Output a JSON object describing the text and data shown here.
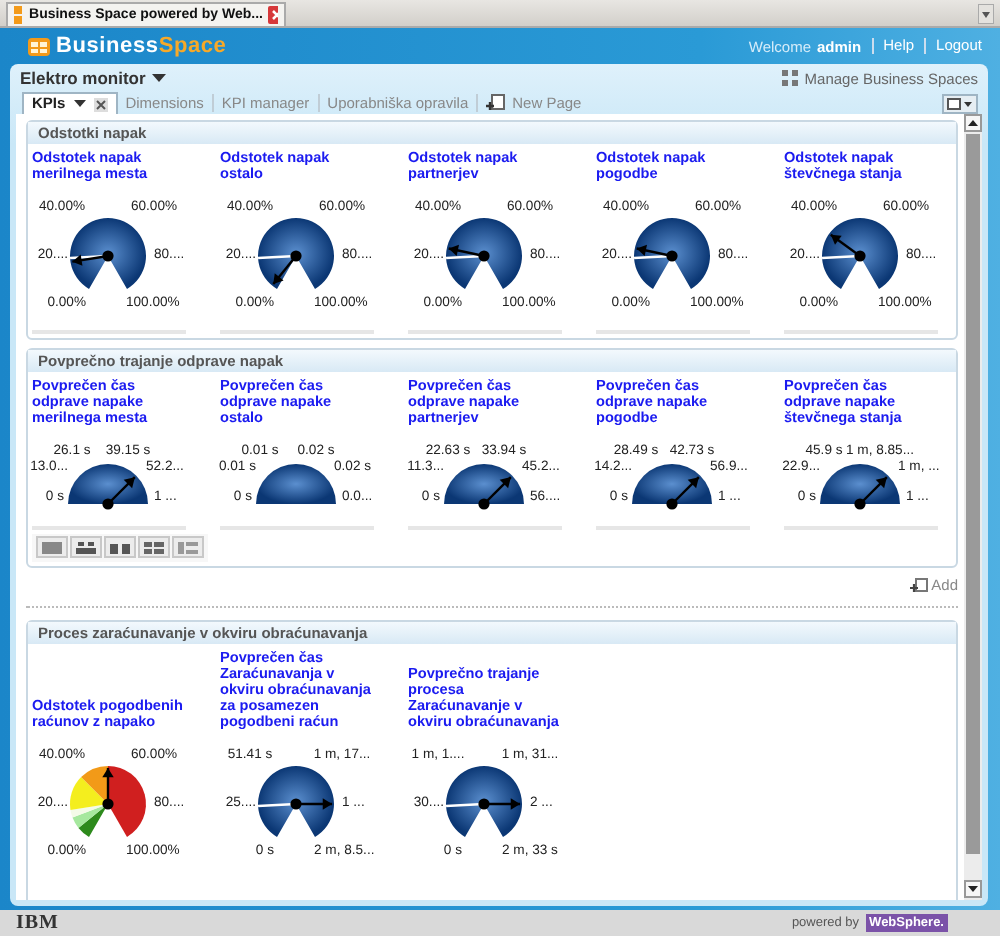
{
  "browser_tab": {
    "title": "Business Space powered by Web..."
  },
  "header": {
    "logo_business": "Business",
    "logo_space": "Space",
    "welcome": "Welcome",
    "user": "admin",
    "links": [
      "Help",
      "Logout"
    ]
  },
  "space": {
    "title": "Elektro monitor",
    "manage": "Manage Business Spaces"
  },
  "tabs": [
    {
      "label": "KPIs",
      "selected": true
    },
    {
      "label": "Dimensions",
      "selected": false
    },
    {
      "label": "KPI manager",
      "selected": false
    },
    {
      "label": "Uporabniška opravila",
      "selected": false
    }
  ],
  "new_page": "New Page",
  "sections": [
    {
      "title": "Odstotki napak",
      "gauges": [
        {
          "title": "Odstotek napak merilnega mesta",
          "kind": "pie",
          "labels": [
            "40.00%",
            "60.00%",
            "20....",
            "80....",
            "0.00%",
            "100.00%"
          ]
        },
        {
          "title": "Odstotek napak ostalo",
          "kind": "pie",
          "labels": [
            "40.00%",
            "60.00%",
            "20....",
            "80....",
            "0.00%",
            "100.00%"
          ]
        },
        {
          "title": "Odstotek napak partnerjev",
          "kind": "pie",
          "labels": [
            "40.00%",
            "60.00%",
            "20....",
            "80....",
            "0.00%",
            "100.00%"
          ]
        },
        {
          "title": "Odstotek napak pogodbe",
          "kind": "pie",
          "labels": [
            "40.00%",
            "60.00%",
            "20....",
            "80....",
            "0.00%",
            "100.00%"
          ]
        },
        {
          "title": "Odstotek napak števčnega stanja",
          "kind": "pie",
          "labels": [
            "40.00%",
            "60.00%",
            "20....",
            "80....",
            "0.00%",
            "100.00%"
          ]
        }
      ]
    },
    {
      "title": "Povprečno trajanje odprave napak",
      "toolbar": true,
      "add": "Add",
      "gauges": [
        {
          "title": "Povprečen čas odprave napake merilnega mesta",
          "kind": "half",
          "labels": [
            "26.1 s",
            "39.15 s",
            "13.0...",
            "52.2...",
            "0 s",
            "1 ..."
          ]
        },
        {
          "title": "Povprečen čas odprave napake ostalo",
          "kind": "half",
          "labels": [
            "0.01 s",
            "0.02 s",
            "0.01 s",
            "0.02 s",
            "0 s",
            "0.0..."
          ]
        },
        {
          "title": "Povprečen čas odprave napake partnerjev",
          "kind": "half",
          "labels": [
            "22.63 s",
            "33.94 s",
            "11.3...",
            "45.2...",
            "0 s",
            "56...."
          ]
        },
        {
          "title": "Povprečen čas odprave napake pogodbe",
          "kind": "half",
          "labels": [
            "28.49 s",
            "42.73 s",
            "14.2...",
            "56.9...",
            "0 s",
            "1 ..."
          ]
        },
        {
          "title": "Povprečen čas odprave napake števčnega stanja",
          "kind": "half",
          "labels": [
            "45.9 s",
            "1 m, 8.85...",
            "22.9...",
            "1 m, ...",
            "0 s",
            "1 ..."
          ]
        }
      ]
    },
    {
      "title": "Proces zaraćunavanje v okviru obraćunavanja",
      "gauges": [
        {
          "title": "Odstotek pogodbenih raćunov z napako",
          "kind": "bands",
          "labels": [
            "40.00%",
            "60.00%",
            "20....",
            "80....",
            "0.00%",
            "100.00%"
          ]
        },
        {
          "title": "Povprečen čas Zaraćunavanja v okviru obraćunavanja za posamezen pogodbeni raćun",
          "kind": "pie",
          "labels": [
            "51.41 s",
            "1 m, 17...",
            "25....",
            "1 ...",
            "0 s",
            "2 m, 8.5..."
          ]
        },
        {
          "title": "Povprečno trajanje procesa Zaraćunavanje v okviru obraćunavanja",
          "kind": "pie",
          "labels": [
            "1 m, 1....",
            "1 m, 31...",
            "30....",
            "2 ...",
            "0 s",
            "2 m, 33 s"
          ]
        }
      ]
    }
  ],
  "footer": {
    "brand": "IBM",
    "powered": "powered by",
    "product": "WebSphere."
  }
}
